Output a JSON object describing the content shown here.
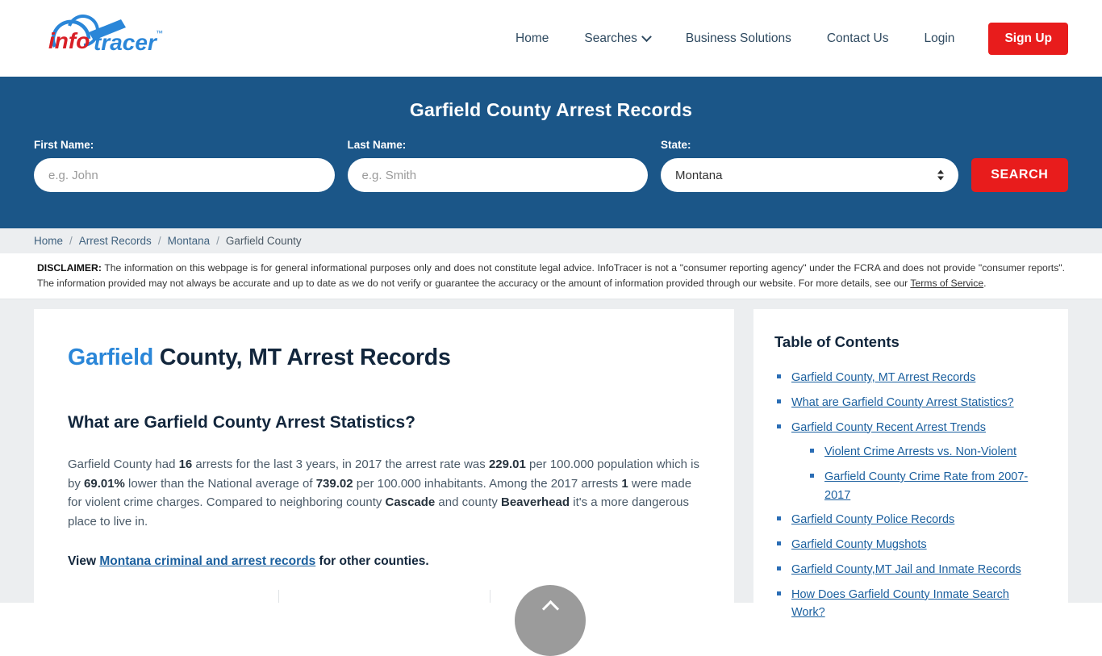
{
  "header": {
    "logo": {
      "text_info": "info",
      "text_tracer": "tracer",
      "tm": "™"
    },
    "nav": [
      {
        "label": "Home",
        "icon": null
      },
      {
        "label": "Searches",
        "icon": "chevron-down-icon"
      },
      {
        "label": "Business Solutions",
        "icon": null
      },
      {
        "label": "Contact Us",
        "icon": null
      },
      {
        "label": "Login",
        "icon": null
      }
    ],
    "signup_label": "Sign Up",
    "signup_color": "#e81c1c"
  },
  "banner": {
    "title": "Garfield County Arrest Records",
    "background_color": "#1b5688",
    "first_name": {
      "label": "First Name:",
      "placeholder": "e.g. John",
      "value": ""
    },
    "last_name": {
      "label": "Last Name:",
      "placeholder": "e.g. Smith",
      "value": ""
    },
    "state": {
      "label": "State:",
      "selected": "Montana",
      "options": [
        "Montana"
      ]
    },
    "search_label": "SEARCH"
  },
  "breadcrumb": {
    "items": [
      "Home",
      "Arrest Records",
      "Montana",
      "Garfield County"
    ],
    "separator": "/"
  },
  "disclaimer": {
    "label": "DISCLAIMER:",
    "line1": " The information on this webpage is for general informational purposes only and does not constitute legal advice. InfoTracer is not a \"consumer reporting agency\" under the FCRA and does not provide \"consumer reports\". The information provided may not always be accurate and up to date as we do not verify or guarantee the accuracy or the amount of information provided through our website. For more details, see our ",
    "tos_link": "Terms of Service",
    "period": "."
  },
  "main": {
    "title_accent": "Garfield",
    "title_rest": " County, MT Arrest Records",
    "section_heading": "What are Garfield County Arrest Statistics?",
    "stats_paragraph": {
      "p1": "Garfield County had ",
      "arrests": "16",
      "p2": " arrests for the last 3 years, in 2017 the arrest rate was ",
      "arrest_rate": "229.01",
      "p3": " per 100.000 population which is by ",
      "pct_lower": "69.01%",
      "p4": " lower than the National average of ",
      "national_average": "739.02",
      "p5": " per 100.000 inhabitants. Among the 2017 arrests ",
      "violent_arrests": "1",
      "p6": " were made for violent crime charges. Compared to neighboring county ",
      "county_a": "Cascade",
      "p7": " and county ",
      "county_b": "Beaverhead",
      "p8": " it's a more dangerous place to live in."
    },
    "view_line": {
      "prefix": "View ",
      "link": "Montana criminal and arrest records",
      "suffix": " for other counties."
    },
    "icons": [
      "handcuffs-icon",
      "trending-up-arrow-icon",
      "pen-icon"
    ]
  },
  "toc": {
    "title": "Table of Contents",
    "items": [
      {
        "label": "Garfield County, MT Arrest Records",
        "sub": []
      },
      {
        "label": "What are Garfield County Arrest Statistics?",
        "sub": []
      },
      {
        "label": "Garfield County Recent Arrest Trends",
        "sub": [
          {
            "label": "Violent Crime Arrests vs. Non-Violent"
          },
          {
            "label": "Garfield County Crime Rate from 2007-2017"
          }
        ]
      },
      {
        "label": "Garfield County Police Records",
        "sub": []
      },
      {
        "label": "Garfield County Mugshots",
        "sub": []
      },
      {
        "label": "Garfield County,MT Jail and Inmate Records",
        "sub": []
      },
      {
        "label": "How Does Garfield County Inmate Search Work?",
        "sub": []
      }
    ]
  },
  "scroll_top": {
    "icon": "chevron-up-icon"
  }
}
